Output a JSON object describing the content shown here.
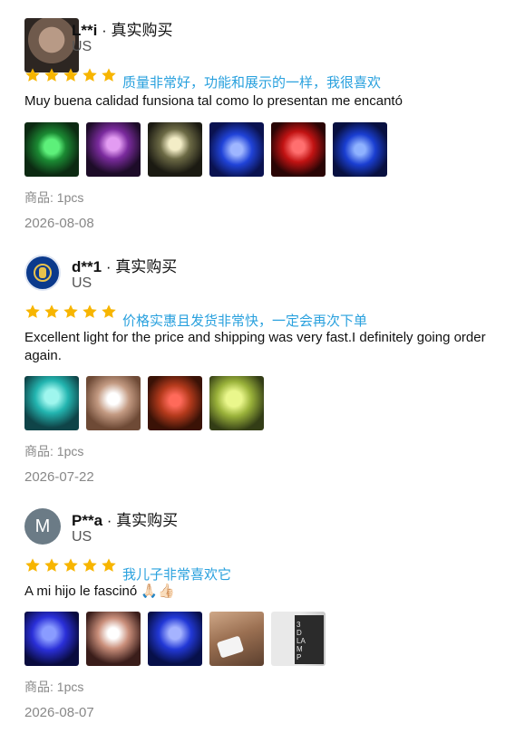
{
  "colors": {
    "star": "#f7b500",
    "translation": "#2aa1de",
    "meta": "#888888"
  },
  "reviews": [
    {
      "name": "L**i",
      "separator": "·",
      "badge": "真实购买",
      "country": "US",
      "rating": 5,
      "translation": "质量非常好，功能和展示的一样，我很喜欢",
      "text": "Muy buena calidad funsiona tal como lo presentan me encantó",
      "photos": [
        "photo-green-lamp",
        "photo-purple-lamp",
        "photo-warm-white-lamp",
        "photo-blue-lamp",
        "photo-red-lamp",
        "photo-blue-lamp-2"
      ],
      "sku": "商品: 1pcs",
      "date": "2026-08-08"
    },
    {
      "name": "d**1",
      "separator": "·",
      "badge": "真实购买",
      "country": "US",
      "rating": 5,
      "translation": "价格实惠且发货非常快，一定会再次下单",
      "text": "Excellent light for the price and shipping was very fast.I definitely going order again.",
      "photos": [
        "photo-cyan-football-lamp",
        "photo-white-football-lamp",
        "photo-red-football-lamp",
        "photo-yellow-football-lamp"
      ],
      "sku": "商品: 1pcs",
      "date": "2026-07-22"
    },
    {
      "name": "P**a",
      "avatar_letter": "M",
      "separator": "·",
      "badge": "真实购买",
      "country": "US",
      "rating": 5,
      "translation": "我儿子非常喜欢它",
      "text": "A mi hijo le fascinó 🙏🏻👍🏻",
      "photos": [
        "photo-blue-football-lamp",
        "photo-white-football-lamp-2",
        "photo-blue-football-lamp-2",
        "photo-remote-control",
        "photo-lamp-box"
      ],
      "box_text": "3D LAMP",
      "sku": "商品: 1pcs",
      "date": "2026-08-07"
    }
  ]
}
